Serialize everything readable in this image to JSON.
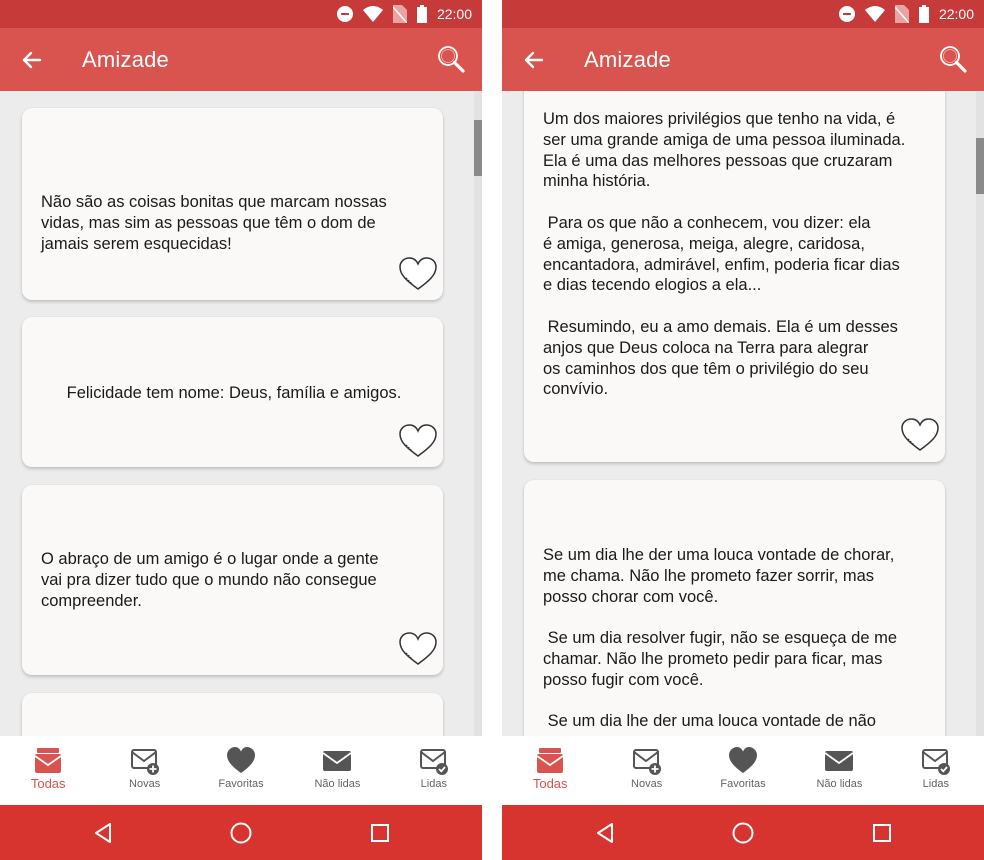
{
  "status_bar": {
    "time": "22:00",
    "icons": [
      "do-not-disturb-icon",
      "wifi-icon",
      "no-sim-icon",
      "battery-icon"
    ]
  },
  "colors": {
    "status_bar": "#c73a3a",
    "app_bar": "#d9534f",
    "system_nav": "#d8342f",
    "card": "#faf9f7",
    "background": "#ececec",
    "accent": "#d9534f"
  },
  "app_bar": {
    "title": "Amizade",
    "back_icon": "arrow-left-icon",
    "search_icon": "search-icon"
  },
  "left_screen": {
    "scroll_position": 0.05,
    "cards": [
      {
        "text": "Não são as coisas bonitas que marcam nossas\nvidas, mas sim as pessoas que têm o dom de\njamais serem esquecidas!"
      },
      {
        "text": "Felicidade tem nome: Deus, família e amigos."
      },
      {
        "text": "O abraço de um amigo é o lugar onde a gente\nvai pra dizer tudo que o mundo não consegue\ncompreender."
      }
    ]
  },
  "right_screen": {
    "scroll_position": 0.08,
    "cards": [
      {
        "text": "Um dos maiores privilégios que tenho na vida, é\nser uma grande amiga de uma pessoa iluminada.\nEla é uma das melhores pessoas que cruzaram\nminha história.\n\n Para os que não a conhecem, vou dizer: ela\né amiga, generosa, meiga, alegre, caridosa,\nencantadora, admirável, enfim, poderia ficar dias\ne dias tecendo elogios a ela...\n\n Resumindo, eu a amo demais. Ela é um desses\nanjos que Deus coloca na Terra para alegrar\nos caminhos dos que têm o privilégio do seu\nconvívio."
      },
      {
        "text": "Se um dia lhe der uma louca vontade de chorar,\nme chama. Não lhe prometo fazer sorrir, mas\nposso chorar com você.\n\n Se um dia resolver fugir, não se esqueça de me\nchamar. Não lhe prometo pedir para ficar, mas\nposso fugir com você.\n\n Se um dia lhe der uma louca vontade de não"
      }
    ]
  },
  "bottom_nav": {
    "active": "Todas",
    "items": [
      {
        "label": "Todas",
        "icon": "mail-stack-icon"
      },
      {
        "label": "Novas",
        "icon": "mail-plus-icon"
      },
      {
        "label": "Favoritas",
        "icon": "heart-icon"
      },
      {
        "label": "Não lidas",
        "icon": "mail-closed-icon"
      },
      {
        "label": "Lidas",
        "icon": "mail-check-icon"
      }
    ]
  },
  "system_nav": {
    "icons": [
      "back-triangle-icon",
      "home-circle-icon",
      "recents-square-icon"
    ]
  }
}
